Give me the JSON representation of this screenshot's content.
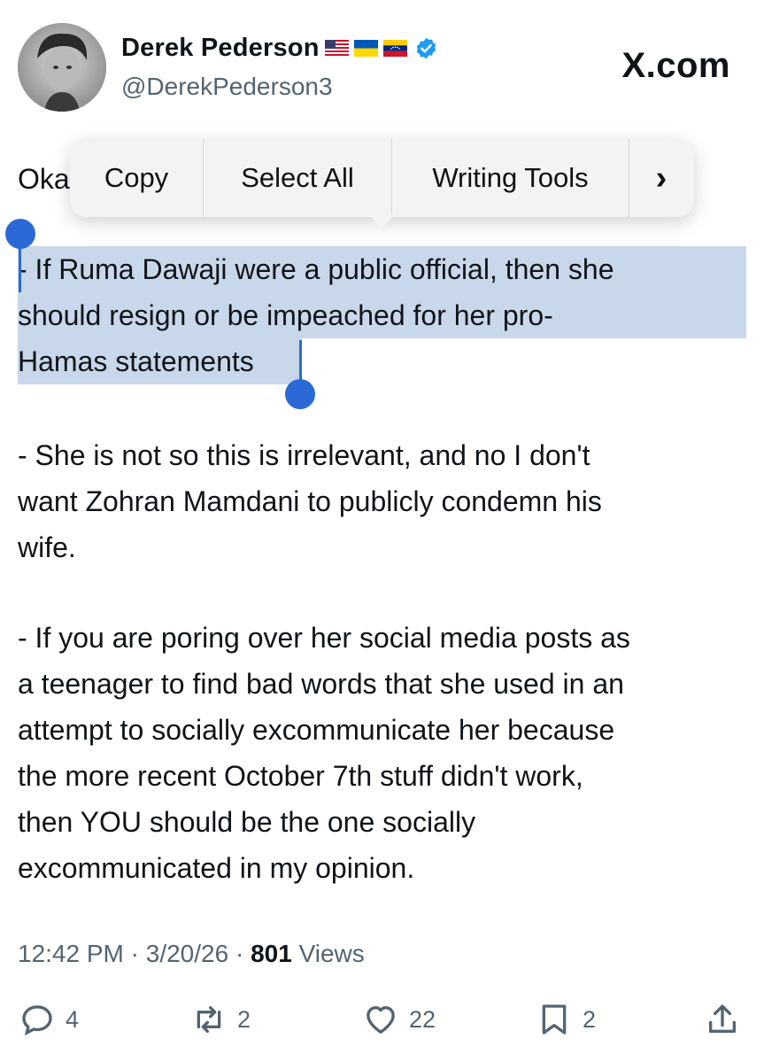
{
  "author": {
    "display_name": "Derek Pederson",
    "flags": [
      "us-flag",
      "ukraine-flag",
      "venezuela-flag"
    ],
    "handle": "@DerekPederson3",
    "verified_color": "#1d9bf0"
  },
  "brand": "X.com",
  "context_menu": {
    "copy": "Copy",
    "select_all": "Select All",
    "writing_tools": "Writing Tools",
    "more": "›"
  },
  "tweet": {
    "intro_partial": "Oka",
    "lines_selected": [
      "- If Ruma Dawaji were a public official, then she",
      "should resign or be impeached for her pro-",
      "Hamas statements"
    ],
    "paragraph2": [
      "- She is not so this is irrelevant, and no I don't",
      "want Zohran Mamdani to publicly condemn his",
      "wife."
    ],
    "paragraph3": [
      "- If you are poring over her social media posts as",
      "a teenager to find bad words that she used in an",
      "attempt to socially excommunicate her because",
      "the more recent October 7th stuff didn't work,",
      "then YOU should be the one socially",
      "excommunicated in my opinion."
    ]
  },
  "meta": {
    "time": "12:42 PM",
    "date": "3/20/26",
    "views_count": "801",
    "views_label": "Views"
  },
  "actions": {
    "replies": "4",
    "reposts": "2",
    "likes": "22",
    "bookmarks": "2"
  },
  "colors": {
    "selection": "#c9d7ea",
    "handle": "#2b6ad6",
    "secondary_text": "#536471"
  }
}
